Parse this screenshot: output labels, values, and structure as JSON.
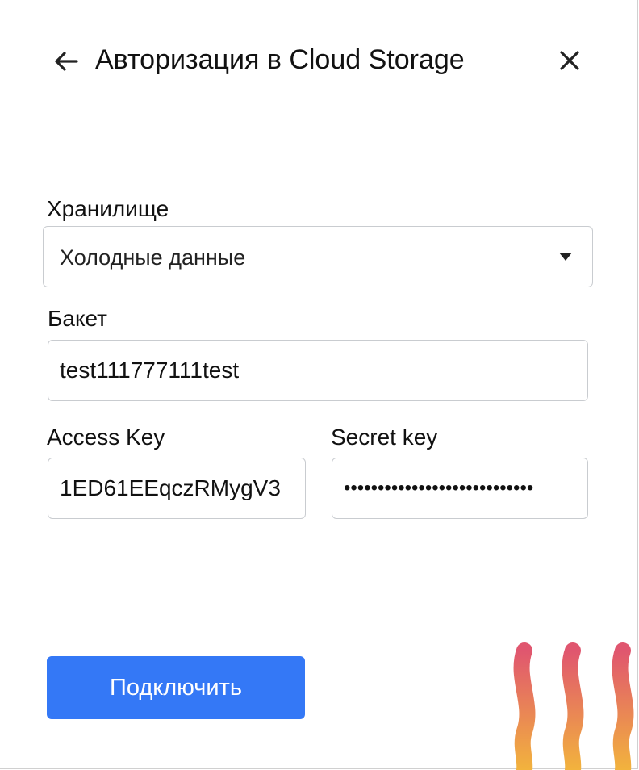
{
  "header": {
    "title": "Авторизация в Cloud Storage",
    "back_icon": "arrow-left-icon",
    "close_icon": "close-icon"
  },
  "form": {
    "storage": {
      "label": "Хранилище",
      "selected": "Холодные данные",
      "icon": "caret-down-icon"
    },
    "bucket": {
      "label": "Бакет",
      "value": "test111777111test"
    },
    "access_key": {
      "label": "Access Key",
      "value": "1ED61EEqczRMygV3"
    },
    "secret_key": {
      "label": "Secret key",
      "value": "••••••••••••••••••••••••••••"
    }
  },
  "actions": {
    "connect_label": "Подключить"
  },
  "colors": {
    "primary": "#3478f6",
    "decoration_top": "#e0566f",
    "decoration_bottom": "#f2b33d"
  }
}
